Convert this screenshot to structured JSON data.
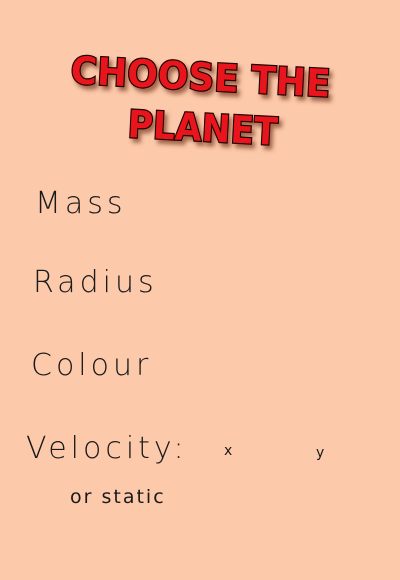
{
  "title": {
    "line1": "CHOOSE THE",
    "line2": "PLANET"
  },
  "fields": {
    "mass_label": "Mass",
    "radius_label": "Radius",
    "colour_label": "Colour",
    "velocity_label": "Velocity:",
    "velocity_x_label": "x",
    "velocity_y_label": "y",
    "static_option_label": "or static"
  },
  "colors": {
    "background": "#fcc9aa",
    "title_fill": "#e8151b",
    "title_outline": "#1a0000",
    "text": "#1a1a1a"
  }
}
